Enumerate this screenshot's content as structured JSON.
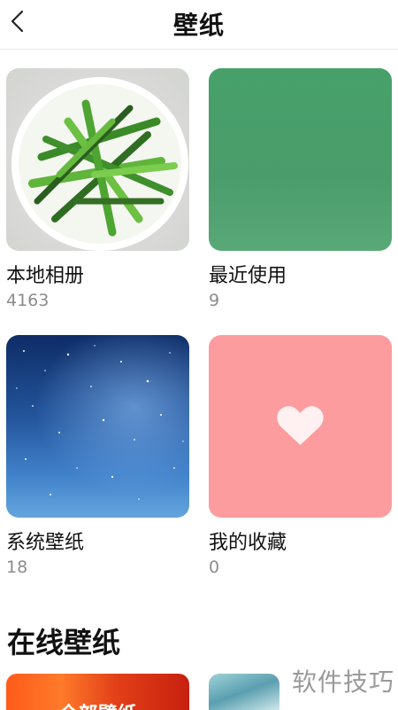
{
  "header": {
    "title": "壁纸"
  },
  "albums": [
    {
      "label": "本地相册",
      "count": "4163"
    },
    {
      "label": "最近使用",
      "count": "9"
    },
    {
      "label": "系统壁纸",
      "count": "18"
    },
    {
      "label": "我的收藏",
      "count": "0"
    }
  ],
  "online": {
    "section_title": "在线壁纸",
    "cards": [
      {
        "label": "全部壁纸"
      }
    ]
  },
  "watermark": "软件技巧",
  "icons": {
    "back": "chevron-left-icon",
    "favorite": "heart-icon"
  },
  "colors": {
    "favorite_bg": "#fc9c9f",
    "recent_bg": "#4a9d6a"
  }
}
